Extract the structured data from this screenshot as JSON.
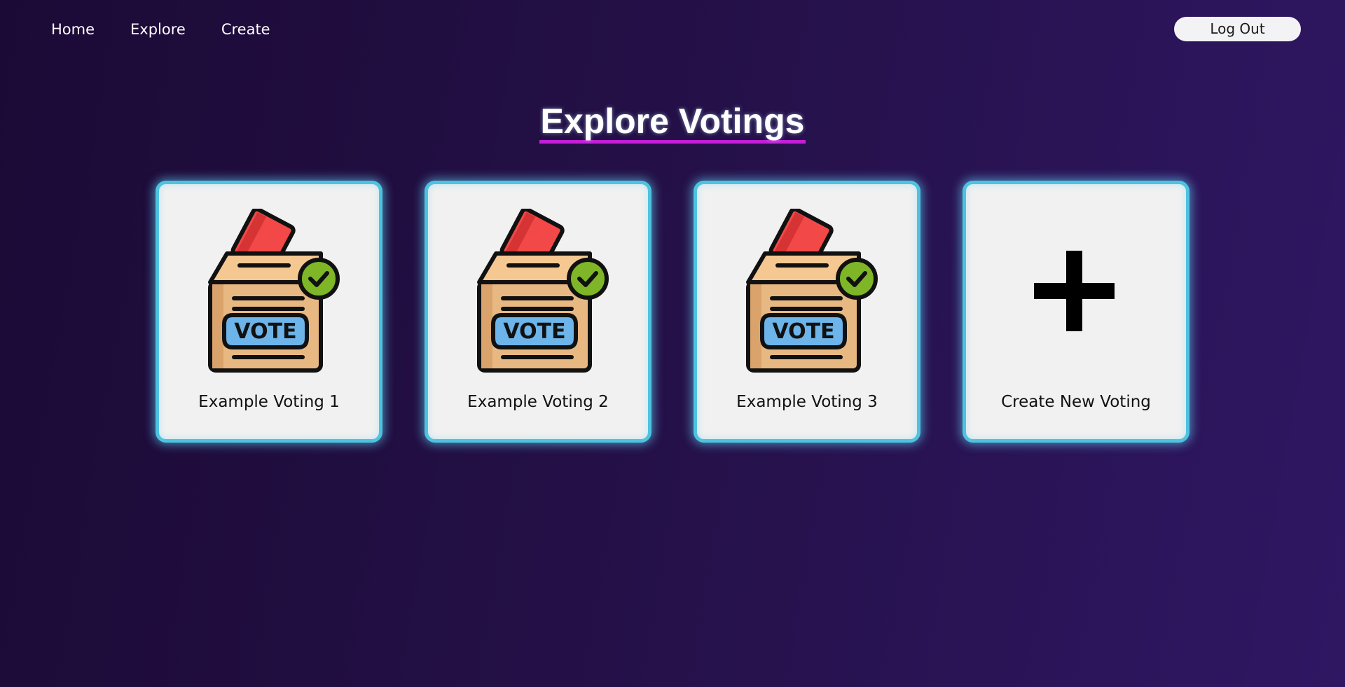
{
  "nav": {
    "links": [
      {
        "label": "Home"
      },
      {
        "label": "Explore"
      },
      {
        "label": "Create"
      }
    ],
    "logout_label": "Log Out"
  },
  "main": {
    "title": "Explore Votings",
    "cards": [
      {
        "label": "Example Voting 1",
        "icon": "ballot-box-icon"
      },
      {
        "label": "Example Voting 2",
        "icon": "ballot-box-icon"
      },
      {
        "label": "Example Voting 3",
        "icon": "ballot-box-icon"
      },
      {
        "label": "Create New Voting",
        "icon": "plus-icon"
      }
    ],
    "ballot_text": "VOTE"
  },
  "colors": {
    "accent_underline": "#c51ed8",
    "card_border": "#4ec3df",
    "card_background": "#f1f1f1",
    "background_start": "#1b0a36",
    "background_end": "#2f1763"
  }
}
